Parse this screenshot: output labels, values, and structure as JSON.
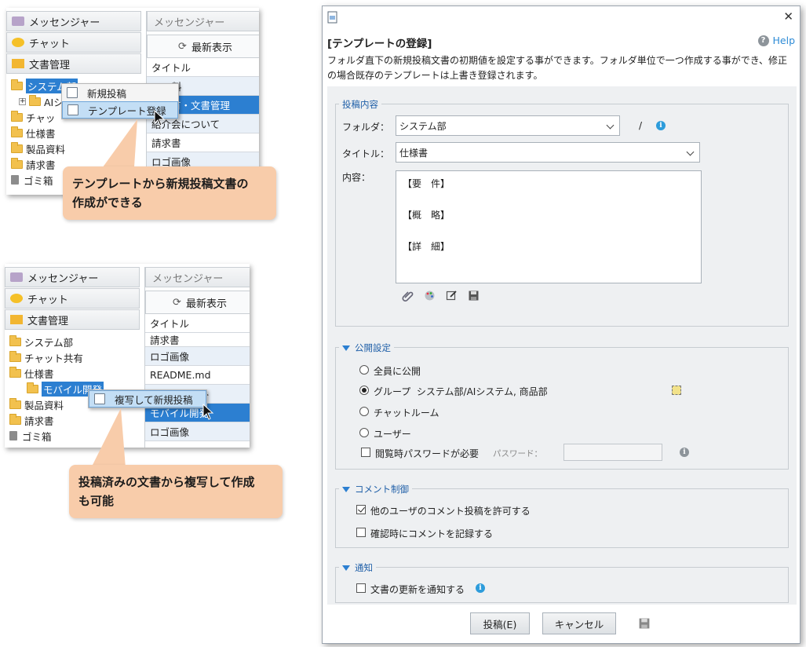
{
  "panel1": {
    "nav": [
      "メッセンジャー",
      "チャット",
      "文書管理"
    ],
    "tab": "メッセンジャー",
    "refresh": "最新表示",
    "tree": [
      "システム部",
      "AIシ",
      "チャッ",
      "仕様書",
      "製品資料",
      "請求書",
      "ゴミ箱"
    ],
    "rows": [
      "タイトル",
      "料",
      "ル共有・文書管理",
      "紹介会について",
      "請求書",
      "ロゴ画像"
    ],
    "menu": [
      "新規投稿",
      "テンプレート登録"
    ],
    "callout": [
      "テンプレートから新規投稿文書の",
      "作成ができる"
    ]
  },
  "panel2": {
    "nav": [
      "メッセンジャー",
      "チャット",
      "文書管理"
    ],
    "tab": "メッセンジャー",
    "refresh": "最新表示",
    "tree": [
      "システム部",
      "チャット共有",
      "仕様書",
      "モバイル開発",
      "製品資料",
      "請求書",
      "ゴミ箱"
    ],
    "rows": [
      "タイトル",
      "請求書",
      "ロゴ画像",
      "README.md",
      "ト",
      "モバイル開発",
      "ロゴ画像"
    ],
    "menu": [
      "複写して新規投稿"
    ],
    "callout": [
      "投稿済みの文書から複写して作成",
      "も可能"
    ]
  },
  "dialog": {
    "title": "[テンプレートの登録]",
    "help": "Help",
    "desc1": "フォルダ直下の新規投稿文書の初期値を設定する事ができます。フォルダ単位で一つ作成する事ができ、修正",
    "desc2": "の場合既存のテンプレートは上書き登録されます。",
    "content_section": "投稿内容",
    "folder_label": "フォルダ：",
    "folder_value": "システム部",
    "slash": "/",
    "title_label": "タイトル：",
    "title_value": "仕様書",
    "body_label": "内容：",
    "body_lines": [
      "【要　件】",
      "【概　略】",
      "【詳　細】"
    ],
    "publish_section": "公開設定",
    "publish_options": [
      "全員に公開",
      "グループ  システム部/AIシステム, 商品部",
      "チャットルーム",
      "ユーザー"
    ],
    "publish_selected": 1,
    "password_check": "閲覧時パスワードが必要",
    "password_label": "パスワード：",
    "comment_section": "コメント制御",
    "comment_opts": [
      "他のユーザのコメント投稿を許可する",
      "確認時にコメントを記録する"
    ],
    "notify_section": "通知",
    "notify_opt": "文書の更新を通知する",
    "submit": "投稿(E)",
    "cancel": "キャンセル"
  },
  "colors": {
    "accent": "#2c7fd1",
    "callout": "#f8ccaa",
    "section": "#1f5fa8"
  }
}
